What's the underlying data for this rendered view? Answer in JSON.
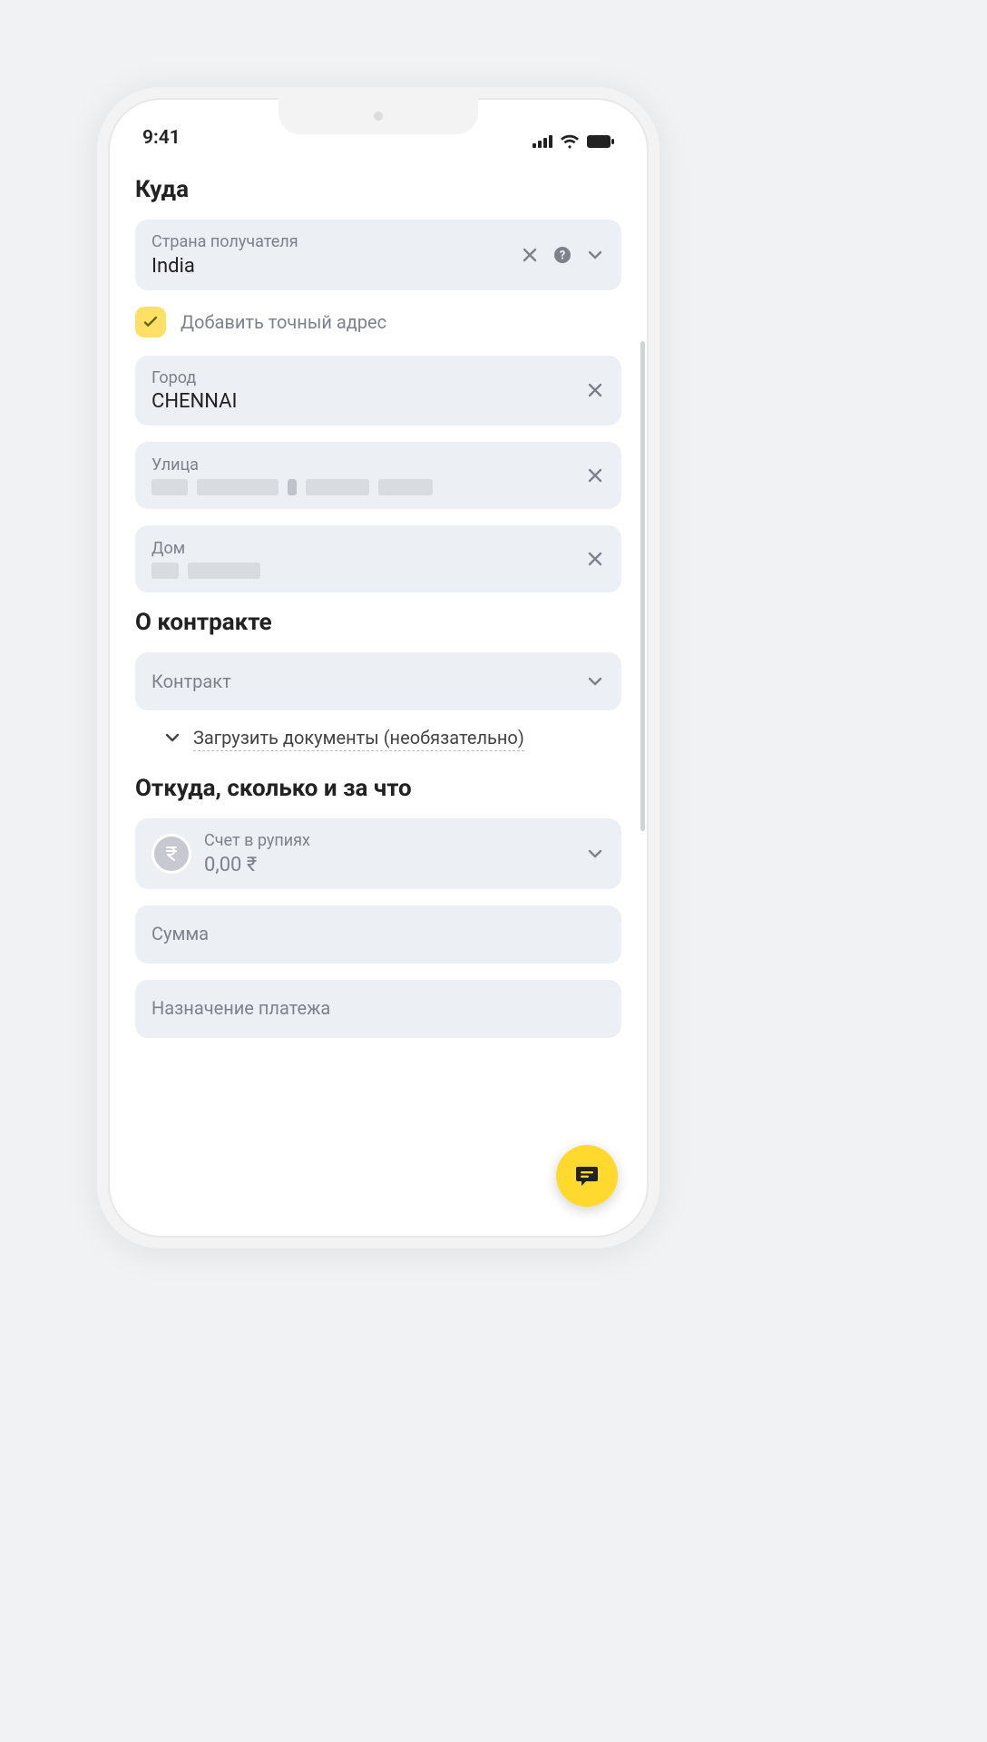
{
  "status": {
    "time": "9:41"
  },
  "sections": {
    "destination": {
      "title": "Куда",
      "country": {
        "label": "Страна получателя",
        "value": "India"
      },
      "add_address_checkbox": "Добавить точный адрес",
      "city": {
        "label": "Город",
        "value": "CHENNAI"
      },
      "street": {
        "label": "Улица"
      },
      "house": {
        "label": "Дом"
      }
    },
    "contract": {
      "title": "О контракте",
      "contract_field_label": "Контракт",
      "upload_docs": "Загрузить документы (необязательно)"
    },
    "payment": {
      "title": "Откуда, сколько и за что",
      "account": {
        "label": "Счет в рупиях",
        "value": "0,00 ₹"
      },
      "amount_label": "Сумма",
      "purpose_label": "Назначение платежа"
    }
  }
}
